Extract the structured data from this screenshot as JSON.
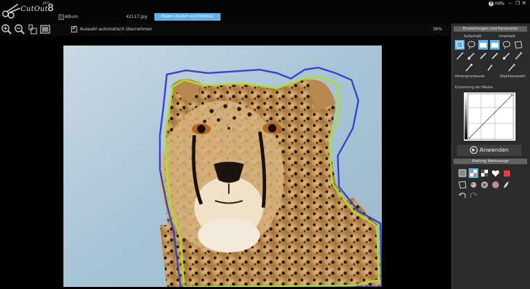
{
  "app": {
    "logo_text": "CutOut",
    "logo_pro": "pro",
    "logo_version": "8"
  },
  "header": {
    "album_label": "Album",
    "file_name": "42117.jpg",
    "active_tab": "Bogen (Außen und Matting)",
    "help_label": "Hilfe",
    "window_controls": [
      "minimize",
      "restore",
      "close"
    ]
  },
  "toolbar": {
    "tools": [
      "zoom-in-icon",
      "zoom-out-icon",
      "actual-size-icon",
      "fit-window-icon"
    ],
    "auto_select_label": "Auswahl automatisch übernehmen",
    "auto_select_checked": true,
    "zoom": "36%"
  },
  "panel": {
    "settings_header": "Einstellungen und Parameter",
    "outside_label": "Außerhalb",
    "inside_label": "Innerhalb",
    "background_brush_label": "Hintergrundausw.",
    "object_select_label": "Objektauswahl",
    "mask_curve_label": "Krümmung der Maske",
    "apply_label": "Anwenden",
    "matting_header": "Matting Werkzeuge"
  },
  "colors": {
    "accent": "#5fb2e6",
    "outer_outline": "#3a43c9",
    "inner_outline": "#a8e02a"
  }
}
